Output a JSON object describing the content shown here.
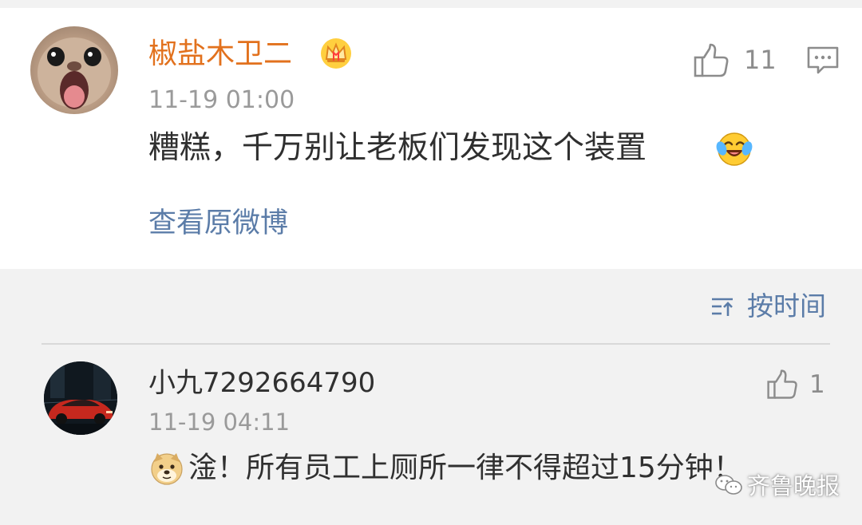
{
  "main_comment": {
    "username": "椒盐木卫二",
    "timestamp": "11-19 01:00",
    "text": "糟糕，千万别让老板们发现这个装置",
    "like_count": "11",
    "view_original_label": "查看原微博",
    "badge_icon": "crown-badge-icon",
    "emoji_icon": "laughing-crying-emoji-icon"
  },
  "sort": {
    "label": "按时间",
    "icon": "sort-lines-icon"
  },
  "reply": {
    "username": "小九7292664790",
    "timestamp": "11-19 04:11",
    "text": "淦！所有员工上厕所一律不得超过15分钟！",
    "like_count": "1",
    "emoji_icon": "doge-emoji-icon"
  },
  "watermark": {
    "text": "齐鲁晚报",
    "icon": "wechat-icon"
  },
  "colors": {
    "username_main": "#e2711d",
    "link_blue": "#5b7ca8",
    "muted": "#9a9a9a",
    "text": "#2f2f2f",
    "section_bg": "#f2f2f2",
    "card_bg": "#ffffff"
  }
}
